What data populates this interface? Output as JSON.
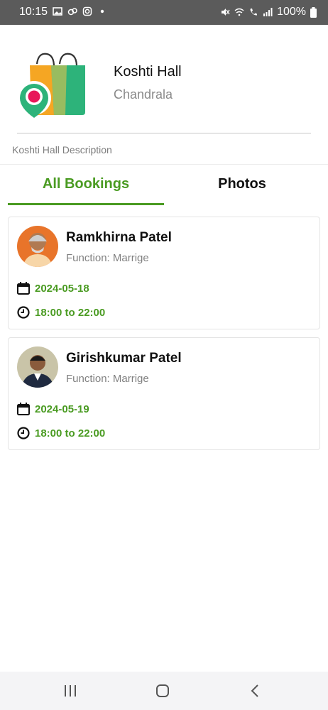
{
  "status_bar": {
    "time": "10:15",
    "battery": "100%"
  },
  "header": {
    "hall_name": "Koshti Hall",
    "city": "Chandrala",
    "description": "Koshti Hall Description",
    "logo_icon": "shopping-bag-location-icon"
  },
  "tabs": [
    {
      "label": "All Bookings",
      "active": true
    },
    {
      "label": "Photos",
      "active": false
    }
  ],
  "bookings": [
    {
      "name": "Ramkhirna Patel",
      "function": "Function: Marrige",
      "date": "2024-05-18",
      "time": "18:00 to 22:00"
    },
    {
      "name": "Girishkumar Patel",
      "function": "Function: Marrige",
      "date": "2024-05-19",
      "time": "18:00 to 22:00"
    }
  ],
  "colors": {
    "accent": "#4a9b22",
    "status_bar": "#5b5b5b",
    "bag_orange": "#f5a623",
    "bag_green": "#2db37a",
    "pin_red": "#e8185a"
  },
  "nav": {
    "recents_icon": "recents-icon",
    "home_icon": "home-icon",
    "back_icon": "back-icon"
  }
}
